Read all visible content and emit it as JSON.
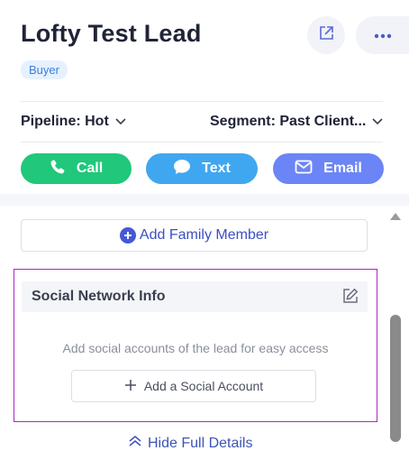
{
  "lead": {
    "name": "Lofty Test Lead",
    "badge": "Buyer"
  },
  "filters": {
    "pipeline_label": "Pipeline: Hot",
    "segment_label": "Segment: Past Client..."
  },
  "actions": {
    "call": "Call",
    "text": "Text",
    "email": "Email"
  },
  "details": {
    "add_family": "Add Family Member",
    "social_title": "Social Network Info",
    "social_hint": "Add social accounts of the lead for easy access",
    "add_social": "Add a Social Account",
    "hide_details": "Hide Full Details"
  },
  "colors": {
    "call": "#21c77a",
    "text": "#3fa7f0",
    "email": "#6b85f6",
    "highlight_border": "#b023c7",
    "link": "#3b55b8"
  },
  "icons": [
    "share-icon",
    "more-icon",
    "chevron-down-icon",
    "phone-icon",
    "chat-icon",
    "mail-icon",
    "plus-circle-icon",
    "edit-icon",
    "plus-icon",
    "double-chevron-up-icon"
  ]
}
